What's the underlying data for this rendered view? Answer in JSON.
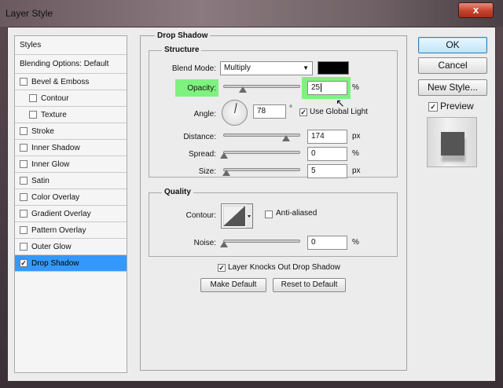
{
  "window": {
    "title": "Layer Style",
    "close_label": "x"
  },
  "left_panel": {
    "items": [
      {
        "label": "Styles",
        "type": "header"
      },
      {
        "label": "Blending Options: Default",
        "type": "header"
      },
      {
        "label": "Bevel & Emboss",
        "checked": false
      },
      {
        "label": "Contour",
        "checked": false,
        "sub": true
      },
      {
        "label": "Texture",
        "checked": false,
        "sub": true
      },
      {
        "label": "Stroke",
        "checked": false
      },
      {
        "label": "Inner Shadow",
        "checked": false
      },
      {
        "label": "Inner Glow",
        "checked": false
      },
      {
        "label": "Satin",
        "checked": false
      },
      {
        "label": "Color Overlay",
        "checked": false
      },
      {
        "label": "Gradient Overlay",
        "checked": false
      },
      {
        "label": "Pattern Overlay",
        "checked": false
      },
      {
        "label": "Outer Glow",
        "checked": false
      },
      {
        "label": "Drop Shadow",
        "checked": true,
        "selected": true
      }
    ]
  },
  "drop_shadow": {
    "section_title": "Drop Shadow",
    "structure_title": "Structure",
    "blend_mode_label": "Blend Mode:",
    "blend_mode_value": "Multiply",
    "shadow_color": "#000000",
    "opacity_label": "Opacity:",
    "opacity_value": "25",
    "opacity_unit": "%",
    "angle_label": "Angle:",
    "angle_value": "78",
    "angle_unit": "°",
    "use_global_light_label": "Use Global Light",
    "use_global_light": true,
    "distance_label": "Distance:",
    "distance_value": "174",
    "distance_unit": "px",
    "spread_label": "Spread:",
    "spread_value": "0",
    "spread_unit": "%",
    "size_label": "Size:",
    "size_value": "5",
    "size_unit": "px"
  },
  "quality": {
    "title": "Quality",
    "contour_label": "Contour:",
    "anti_aliased_label": "Anti-aliased",
    "anti_aliased": false,
    "noise_label": "Noise:",
    "noise_value": "0",
    "noise_unit": "%"
  },
  "bottom": {
    "knockout_label": "Layer Knocks Out Drop Shadow",
    "knockout": true,
    "make_default_label": "Make Default",
    "reset_default_label": "Reset to Default"
  },
  "right_panel": {
    "ok_label": "OK",
    "cancel_label": "Cancel",
    "new_style_label": "New Style...",
    "preview_label": "Preview",
    "preview_checked": true
  },
  "colors": {
    "highlight": "#7ef27e",
    "selection": "#3399ff"
  }
}
